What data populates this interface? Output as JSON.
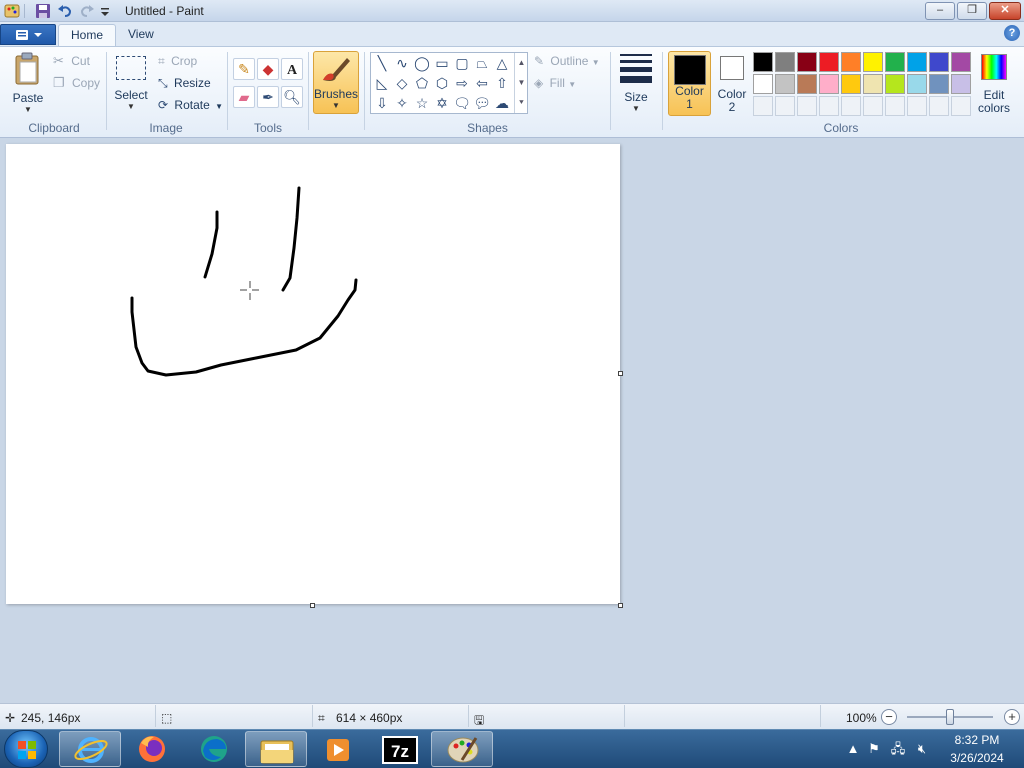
{
  "window": {
    "title": "Untitled - Paint",
    "minimize": "–",
    "restore": "❐",
    "close": "✕"
  },
  "tabs": {
    "home": "Home",
    "view": "View",
    "help": "?"
  },
  "clipboard": {
    "paste": "Paste",
    "cut": "Cut",
    "copy": "Copy",
    "group": "Clipboard"
  },
  "image": {
    "select": "Select",
    "crop": "Crop",
    "resize": "Resize",
    "rotate": "Rotate",
    "group": "Image"
  },
  "tools": {
    "group": "Tools"
  },
  "brushes": {
    "label": "Brushes"
  },
  "shapes": {
    "outline": "Outline",
    "fill": "Fill",
    "group": "Shapes"
  },
  "size": {
    "label": "Size"
  },
  "colors": {
    "color1_line1": "Color",
    "color1_line2": "1",
    "color2_line1": "Color",
    "color2_line2": "2",
    "edit_line1": "Edit",
    "edit_line2": "colors",
    "group": "Colors",
    "color1": "#000000",
    "color2": "#ffffff",
    "palette_row1": [
      "#000000",
      "#7f7f7f",
      "#880015",
      "#ed1c24",
      "#ff7f27",
      "#fff200",
      "#22b14c",
      "#00a2e8",
      "#3f48cc",
      "#a349a4"
    ],
    "palette_row2": [
      "#ffffff",
      "#c3c3c3",
      "#b97a57",
      "#ffaec9",
      "#ffc90e",
      "#efe4b0",
      "#b5e61d",
      "#99d9ea",
      "#7092be",
      "#c8bfe7"
    ]
  },
  "status": {
    "cursor_pos": "245, 146px",
    "canvas_size": "614 × 460px",
    "zoom": "100%"
  },
  "tray": {
    "time": "8:32 PM",
    "date": "3/26/2024"
  }
}
